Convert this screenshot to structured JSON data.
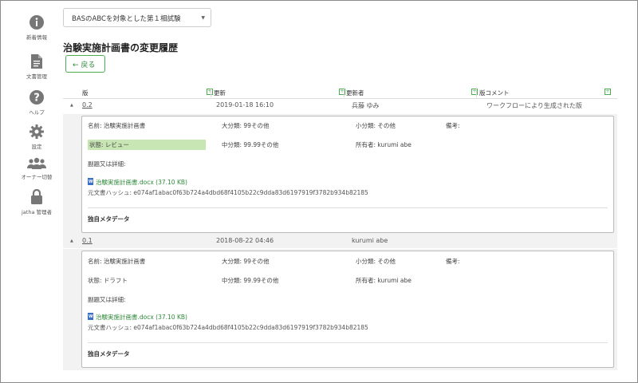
{
  "sidebar": {
    "items": [
      {
        "label": "新着情報",
        "icon": "info-icon"
      },
      {
        "label": "文書管理",
        "icon": "document-icon"
      },
      {
        "label": "ヘルプ",
        "icon": "help-icon"
      },
      {
        "label": "設定",
        "icon": "gear-icon"
      },
      {
        "label": "オーナー切替",
        "icon": "users-icon"
      },
      {
        "label": "jatha 管理者",
        "icon": "lock-icon"
      }
    ]
  },
  "project_select": {
    "value": "BASのABCを対象とした第１相試験"
  },
  "page_title": "治験実施計画書の変更履歴",
  "back_button": "← 戻る",
  "table": {
    "columns": [
      "版",
      "更新",
      "更新者",
      "版コメント"
    ],
    "sort_icon": "+"
  },
  "versions": [
    {
      "version": "0.2",
      "updated": "2019-01-18 16:10",
      "updated_by": "兵藤 ゆみ",
      "comment": "ワークフローにより生成された版",
      "name": "名前: 治験実施計画書",
      "major": "大分類: 99その他",
      "minor": "小分類: その他",
      "remarks": "備考:",
      "status": "状態: レビュー",
      "middle": "中分類: 99.99その他",
      "owner": "所有者: kurumi abe",
      "subtitle": "副題又は詳細:",
      "file": "治験実施計画書.docx (37.10 KB)",
      "hash": "元文書ハッシュ: e074af1abac0f63b724a4dbd68f4105b22c9dda83d6197919f3782b934b82185",
      "meta": "独自メタデータ"
    },
    {
      "version": "0.1",
      "updated": "2018-08-22 04:46",
      "updated_by": "kurumi abe",
      "comment": "",
      "name": "名前: 治験実施計画書",
      "major": "大分類: 99その他",
      "minor": "小分類: その他",
      "remarks": "備考:",
      "status": "状態: ドラフト",
      "middle": "中分類: 99.99その他",
      "owner": "所有者: kurumi abe",
      "subtitle": "副題又は詳細:",
      "file": "治験実施計画書.docx (37.10 KB)",
      "hash": "元文書ハッシュ: e074af1abac0f63b724a4dbd68f4105b22c9dda83d6197919f3782b934b82185",
      "meta": "独自メタデータ"
    }
  ],
  "colors": {
    "accent": "#4caf50",
    "status_highlight": "#c8e6b4",
    "icon_gray": "#777777",
    "file_icon": "#3b6fc9"
  }
}
